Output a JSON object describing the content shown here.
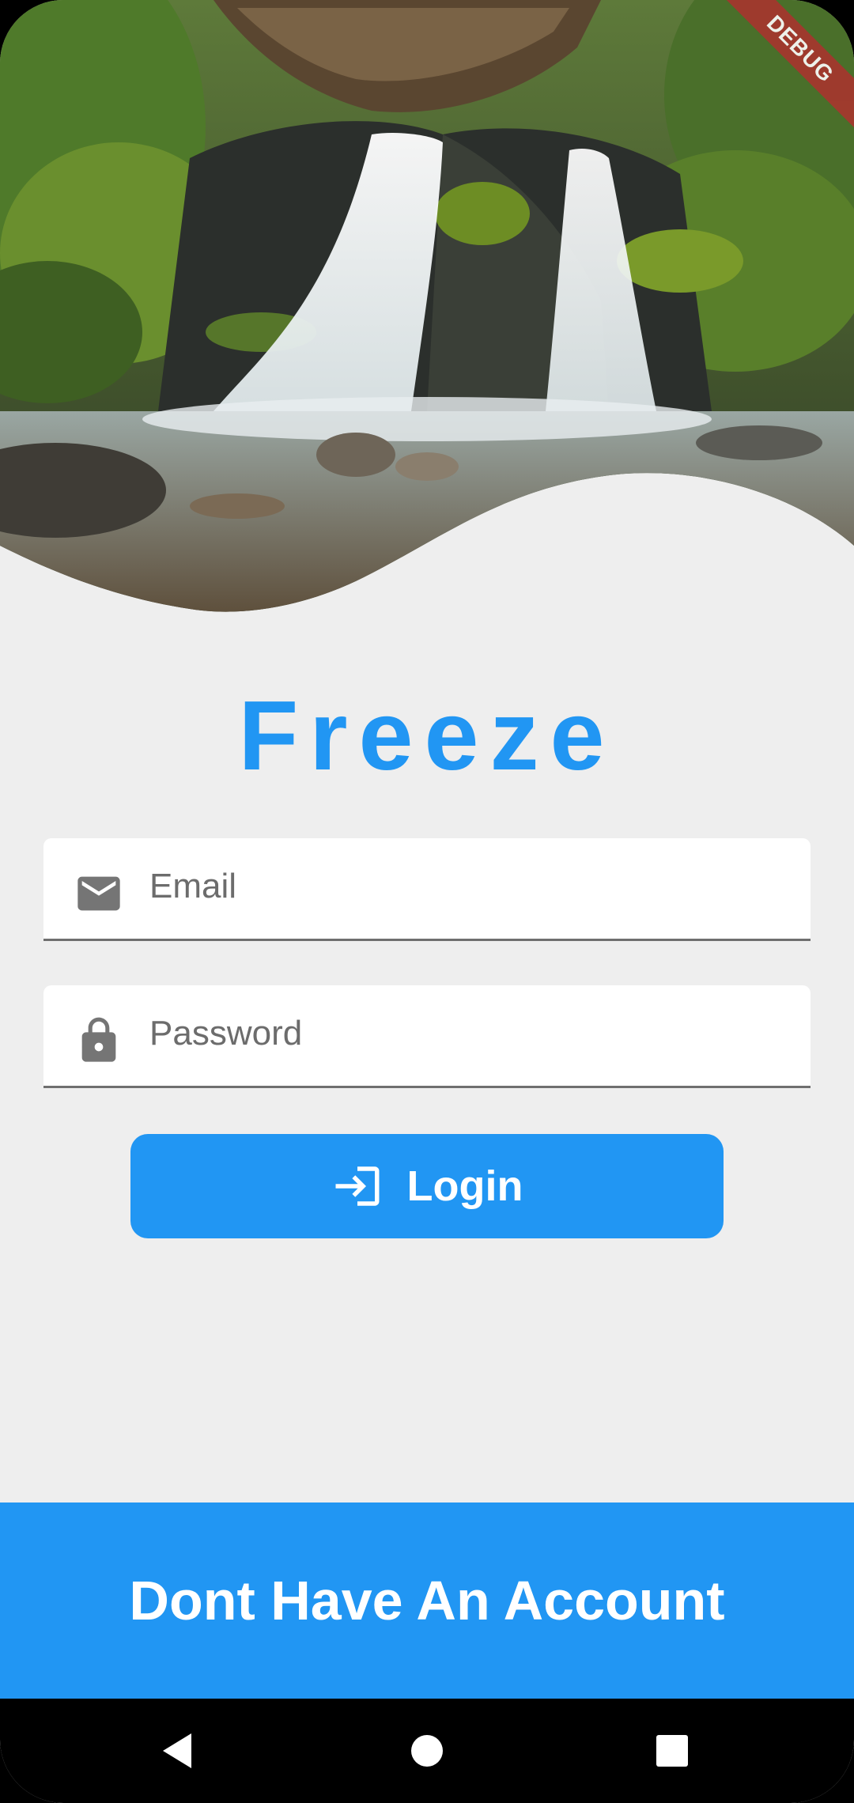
{
  "debug_banner": "DEBUG",
  "hero": {
    "image": "waterfall-forest-photo"
  },
  "app": {
    "title": "Freeze"
  },
  "form": {
    "email": {
      "placeholder": "Email",
      "value": "",
      "icon": "mail-icon"
    },
    "password": {
      "placeholder": "Password",
      "value": "",
      "icon": "lock-icon"
    }
  },
  "login_button": {
    "label": "Login",
    "icon": "login-icon"
  },
  "signup": {
    "label": "Dont Have An Account"
  },
  "colors": {
    "primary": "#2196f3",
    "background": "#eeeeee",
    "icon_grey": "#757575"
  },
  "system_nav": {
    "back": "back-icon",
    "home": "home-icon",
    "recents": "recents-icon"
  }
}
